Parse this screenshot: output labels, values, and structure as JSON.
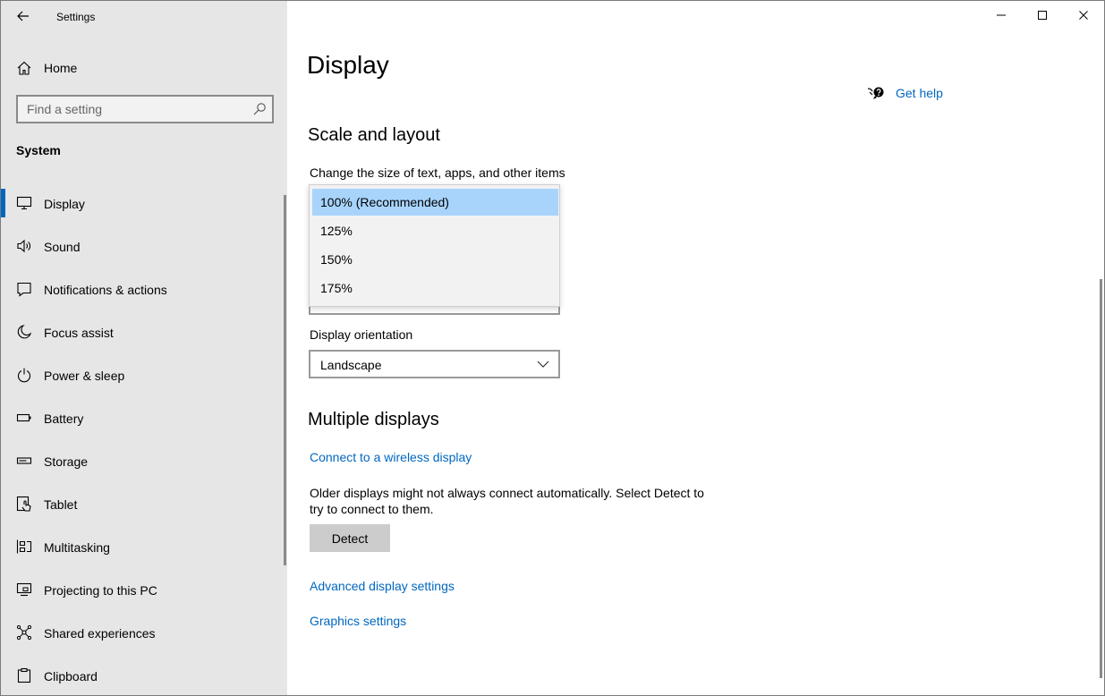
{
  "window": {
    "app_title": "Settings",
    "controls": {
      "minimize": "minimize-icon",
      "maximize": "maximize-icon",
      "close": "close-icon"
    }
  },
  "sidebar": {
    "home_label": "Home",
    "search": {
      "placeholder": "Find a setting",
      "value": ""
    },
    "section_heading": "System",
    "items": [
      {
        "label": "Display",
        "icon": "monitor-icon",
        "selected": true
      },
      {
        "label": "Sound",
        "icon": "speaker-icon",
        "selected": false
      },
      {
        "label": "Notifications & actions",
        "icon": "notification-icon",
        "selected": false
      },
      {
        "label": "Focus assist",
        "icon": "moon-icon",
        "selected": false
      },
      {
        "label": "Power & sleep",
        "icon": "power-icon",
        "selected": false
      },
      {
        "label": "Battery",
        "icon": "battery-icon",
        "selected": false
      },
      {
        "label": "Storage",
        "icon": "storage-icon",
        "selected": false
      },
      {
        "label": "Tablet",
        "icon": "tablet-icon",
        "selected": false
      },
      {
        "label": "Multitasking",
        "icon": "multitasking-icon",
        "selected": false
      },
      {
        "label": "Projecting to this PC",
        "icon": "projecting-icon",
        "selected": false
      },
      {
        "label": "Shared experiences",
        "icon": "shared-icon",
        "selected": false
      },
      {
        "label": "Clipboard",
        "icon": "clipboard-icon",
        "selected": false
      }
    ]
  },
  "main": {
    "page_title": "Display",
    "help_label": "Get help",
    "scale_section": {
      "heading": "Scale and layout",
      "scale_label": "Change the size of text, apps, and other items",
      "scale_options": [
        "100% (Recommended)",
        "125%",
        "150%",
        "175%"
      ],
      "scale_selected": "100% (Recommended)",
      "orientation_label": "Display orientation",
      "orientation_value": "Landscape"
    },
    "multiple_section": {
      "heading": "Multiple displays",
      "wireless_link": "Connect to a wireless display",
      "detect_text": "Older displays might not always connect automatically. Select Detect to try to connect to them.",
      "detect_button": "Detect",
      "advanced_link": "Advanced display settings",
      "graphics_link": "Graphics settings"
    }
  },
  "colors": {
    "accent": "#0067c0",
    "sidebar_bg": "#e6e6e6",
    "selected_option": "#a8d4fc"
  }
}
